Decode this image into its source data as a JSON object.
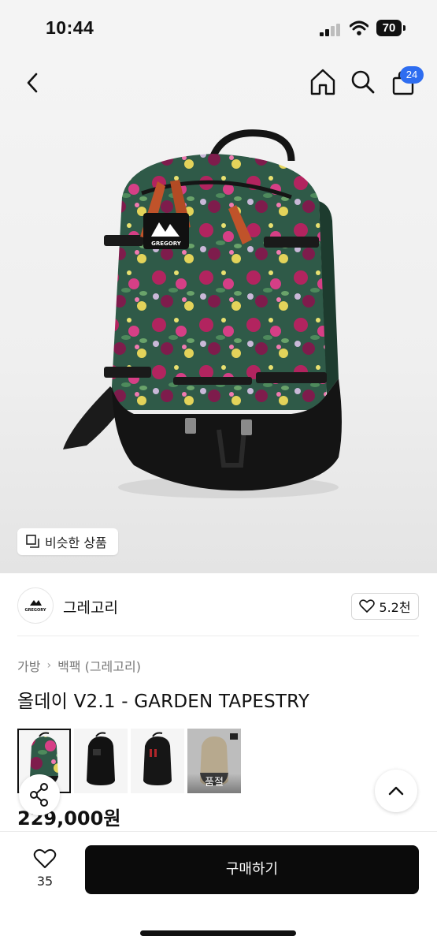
{
  "status_bar": {
    "time": "10:44",
    "battery": "70"
  },
  "nav": {
    "cart_badge": "24",
    "icons": [
      "back-chevron-icon",
      "home-icon",
      "search-icon",
      "cart-icon"
    ]
  },
  "hero": {
    "similar_label": "비슷한 상품",
    "logo_text": "GREGORY"
  },
  "brand": {
    "logo_text": "GREGORY",
    "name": "그레고리",
    "like_count": "5.2천"
  },
  "breadcrumb": {
    "items": [
      "가방",
      "백팩 (그레고리)"
    ]
  },
  "product": {
    "title": "올데이 V2.1 - GARDEN TAPESTRY",
    "price": "229,000원"
  },
  "thumbnails": [
    {
      "variant": "floral",
      "selected": true,
      "label": ""
    },
    {
      "variant": "black",
      "selected": false,
      "label": ""
    },
    {
      "variant": "black-red",
      "selected": false,
      "label": ""
    },
    {
      "variant": "beige",
      "selected": false,
      "label": "품절"
    }
  ],
  "bottom_bar": {
    "wish_count": "35",
    "buy_label": "구매하기"
  },
  "colors": {
    "accent_badge": "#2e6df0",
    "buy_button": "#0b0b0b",
    "strap_orange": "#c0532a"
  }
}
